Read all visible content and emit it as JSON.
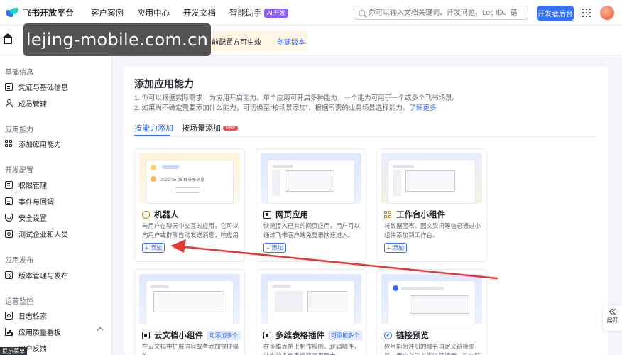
{
  "brand": {
    "name": "飞书开放平台"
  },
  "nav": {
    "items": [
      "客户案例",
      "应用中心",
      "开发文档",
      "智能助手"
    ],
    "ai_badge": "AI 开发"
  },
  "search": {
    "placeholder": "你可以输入文档关键词、开发问题、Log ID、错误码"
  },
  "header": {
    "dev_console": "开发者后台"
  },
  "notice": {
    "text": "前配置方可生效",
    "link": "创建版本"
  },
  "watermark": "lejing-mobile.com.cn",
  "sidebar": {
    "groups": [
      {
        "label": "基础信息",
        "items": [
          "凭证与基础信息",
          "成员管理"
        ]
      },
      {
        "label": "应用能力",
        "items": [
          "添加应用能力"
        ]
      },
      {
        "label": "开发配置",
        "items": [
          "权限管理",
          "事件与回调",
          "安全设置",
          "测试企业和人员"
        ]
      },
      {
        "label": "应用发布",
        "items": [
          "版本管理与发布"
        ]
      },
      {
        "label": "运营监控",
        "items": [
          "日志检索",
          "应用质量看板",
          "用户反馈"
        ]
      }
    ],
    "menu_tip": "提示菜单"
  },
  "main": {
    "title": "添加应用能力",
    "desc1": "1. 你可以根据实际需求，为应用开启能力。单个应用可开启多种能力，一个能力可用于一个或多个飞书场景。",
    "desc2": "2. 如果尚不确定需要添加什么能力，可切换至“按场景添加”，根据所需的业务场景选择能力。",
    "desc_more": "了解更多",
    "tabs": [
      {
        "label": "按能力添加",
        "active": true
      },
      {
        "label": "按场景添加",
        "badge": "new"
      }
    ],
    "cards": [
      {
        "title": "机器人",
        "icon": "robot-icon",
        "desc": "与用户在聊天中交互的应用，它可以向用户或群聊自动发送消息，响应用户的消...",
        "button": "+ 添加",
        "thumb_text": "2022-05-26 群分享消息"
      },
      {
        "title": "网页应用",
        "icon": "web-app-icon",
        "desc": "快速接入已有的网页应用，用户可以通过飞书客户端免登录快速进入。",
        "button": "+ 添加"
      },
      {
        "title": "工作台小组件",
        "icon": "widget-icon",
        "desc": "将数据图表、图文资讯等信息通过小组件添加到工作台。",
        "button": "+ 添加"
      },
      {
        "title": "云文档小组件",
        "icon": "doc-widget-icon",
        "tag": "可添加多个",
        "desc": "在云文档中扩展内容或者添加快捷操作。"
      },
      {
        "title": "多维表格插件",
        "icon": "bitable-plugin-icon",
        "tag": "可添加多个",
        "desc": "在多维表格上制作报图、逻辑插件，让你的多维表格变得更强大。"
      },
      {
        "title": "链接预览",
        "icon": "link-preview-icon",
        "desc": "应用能为注册的域名自定义链接预览，用户在飞书发送链接后，能在链接下方展..."
      }
    ]
  },
  "expand": {
    "label": "展开"
  },
  "colors": {
    "accent": "#3370ff",
    "annotation_arrow": "#e53935"
  }
}
